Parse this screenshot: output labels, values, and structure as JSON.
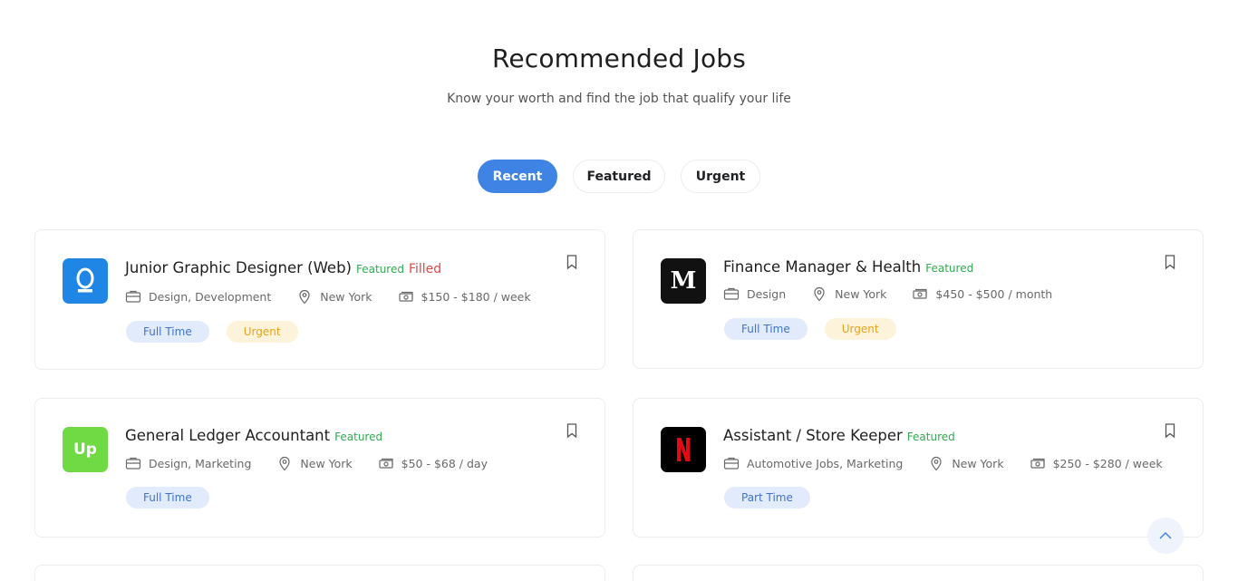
{
  "section": {
    "title": "Recommended Jobs",
    "subtitle": "Know your worth and find the job that qualify your life"
  },
  "tabs": [
    {
      "label": "Recent",
      "active": true
    },
    {
      "label": "Featured",
      "active": false
    },
    {
      "label": "Urgent",
      "active": false
    }
  ],
  "jobs": [
    {
      "title": "Junior Graphic Designer (Web)",
      "featured": "Featured",
      "filled": "Filled",
      "category": "Design, Development",
      "location": "New York",
      "salary": "$150 - $180 / week",
      "tags": [
        "Full Time",
        "Urgent"
      ],
      "logo": {
        "text": "Q",
        "bg": "#1f86e5",
        "fg": "#ffffff"
      }
    },
    {
      "title": "Finance Manager & Health",
      "featured": "Featured",
      "category": "Design",
      "location": "New York",
      "salary": "$450 - $500 / month",
      "tags": [
        "Full Time",
        "Urgent"
      ],
      "logo": {
        "text": "M",
        "bg": "#111111",
        "fg": "#ffffff"
      }
    },
    {
      "title": "General Ledger Accountant",
      "featured": "Featured",
      "category": "Design, Marketing",
      "location": "New York",
      "salary": "$50 - $68 / day",
      "tags": [
        "Full Time"
      ],
      "logo": {
        "text": "Up",
        "bg": "#6fda44",
        "fg": "#ffffff"
      }
    },
    {
      "title": "Assistant / Store Keeper",
      "featured": "Featured",
      "category": "Automotive Jobs, Marketing",
      "location": "New York",
      "salary": "$250 - $280 / week",
      "tags": [
        "Part Time"
      ],
      "logo": {
        "text": "N",
        "bg": "#000000",
        "fg": "#e50914"
      }
    }
  ],
  "colors": {
    "accent": "#3f83e5",
    "featured": "#34a853",
    "filled": "#e04646",
    "tag_blue_bg": "#e2ebfb",
    "tag_yellow_bg": "#fdf3da"
  },
  "icons": {
    "category": "briefcase-icon",
    "location": "map-pin-icon",
    "salary": "money-icon",
    "bookmark": "bookmark-icon",
    "scroll_top": "chevron-up-icon"
  }
}
